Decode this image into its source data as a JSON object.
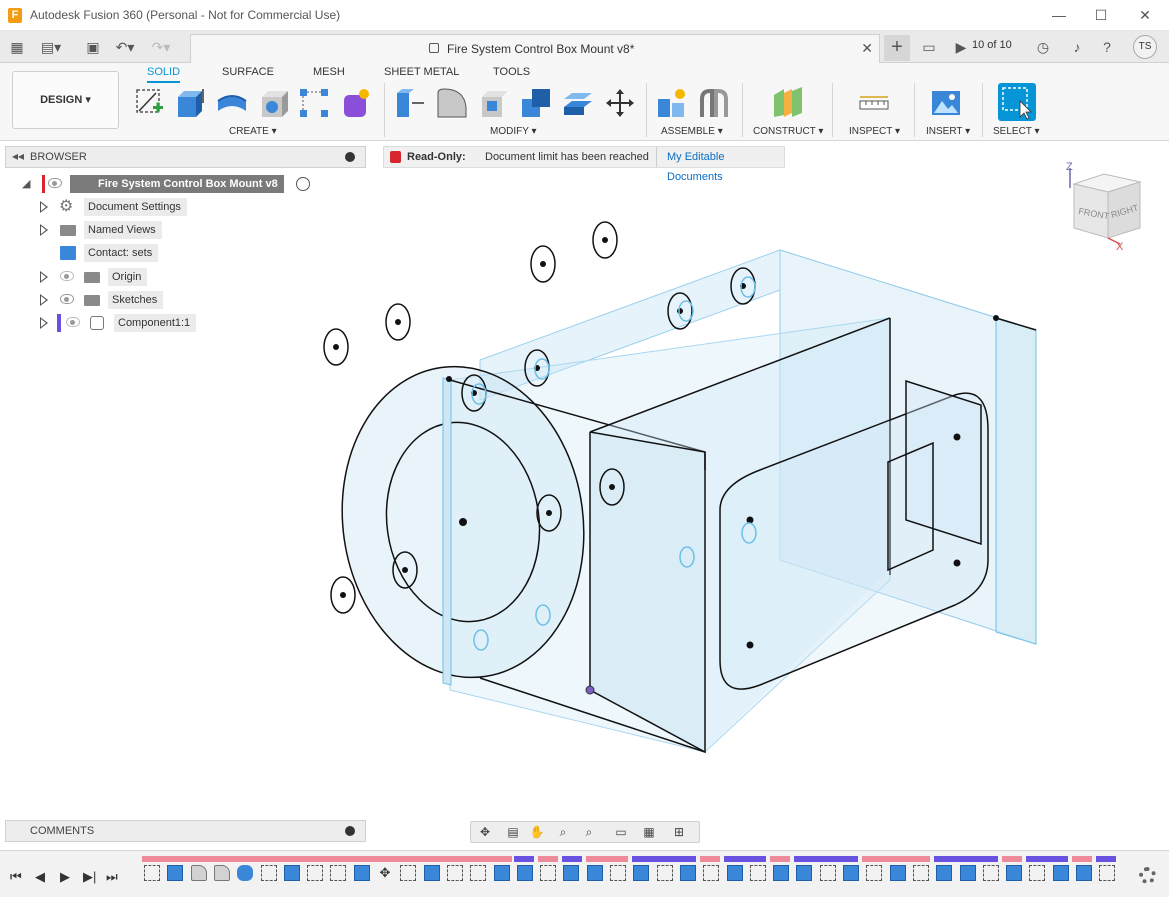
{
  "window": {
    "title": "Autodesk Fusion 360 (Personal - Not for Commercial Use)",
    "app_icon_letter": "F",
    "minimize": "—",
    "maximize": "☐",
    "close": "✕"
  },
  "appbar": {
    "document_title": "Fire System Control Box Mount v8*",
    "tab_close": "✕",
    "new_tab": "+",
    "doc_count": "10 of 10",
    "user_initials": "TS"
  },
  "toolbar": {
    "workspace": "DESIGN ▾",
    "tabs": [
      "SOLID",
      "SURFACE",
      "MESH",
      "SHEET METAL",
      "TOOLS"
    ],
    "groups": {
      "create": "CREATE ▾",
      "modify": "MODIFY ▾",
      "assemble": "ASSEMBLE ▾",
      "construct": "CONSTRUCT ▾",
      "inspect": "INSPECT ▾",
      "insert": "INSERT ▾",
      "select": "SELECT ▾"
    }
  },
  "browser": {
    "title": "BROWSER",
    "collapse": "◂◂",
    "root": "Fire System Control Box Mount v8",
    "items": [
      {
        "label": "Document Settings"
      },
      {
        "label": "Named Views"
      },
      {
        "label": "Contact: sets"
      },
      {
        "label": "Origin"
      },
      {
        "label": "Sketches"
      },
      {
        "label": "Component1:1"
      }
    ]
  },
  "readonly_bar": {
    "label": "Read-Only:",
    "message": "Document limit has been reached",
    "link": "My Editable Documents"
  },
  "viewcube": {
    "top": "Z",
    "front": "FRONT",
    "right": "RIGHT",
    "x_axis": "X"
  },
  "comments": {
    "title": "COMMENTS"
  },
  "timeline": {
    "controls": [
      "⏮",
      "◀",
      "▶",
      "▶|",
      "⏭"
    ]
  },
  "colors": {
    "accent": "#0696d7",
    "readonly_lock": "#d8262f",
    "timeline_pink": "#ef8a9a",
    "timeline_purple": "#6a52e0",
    "body_fill": "#cfe7f5"
  }
}
